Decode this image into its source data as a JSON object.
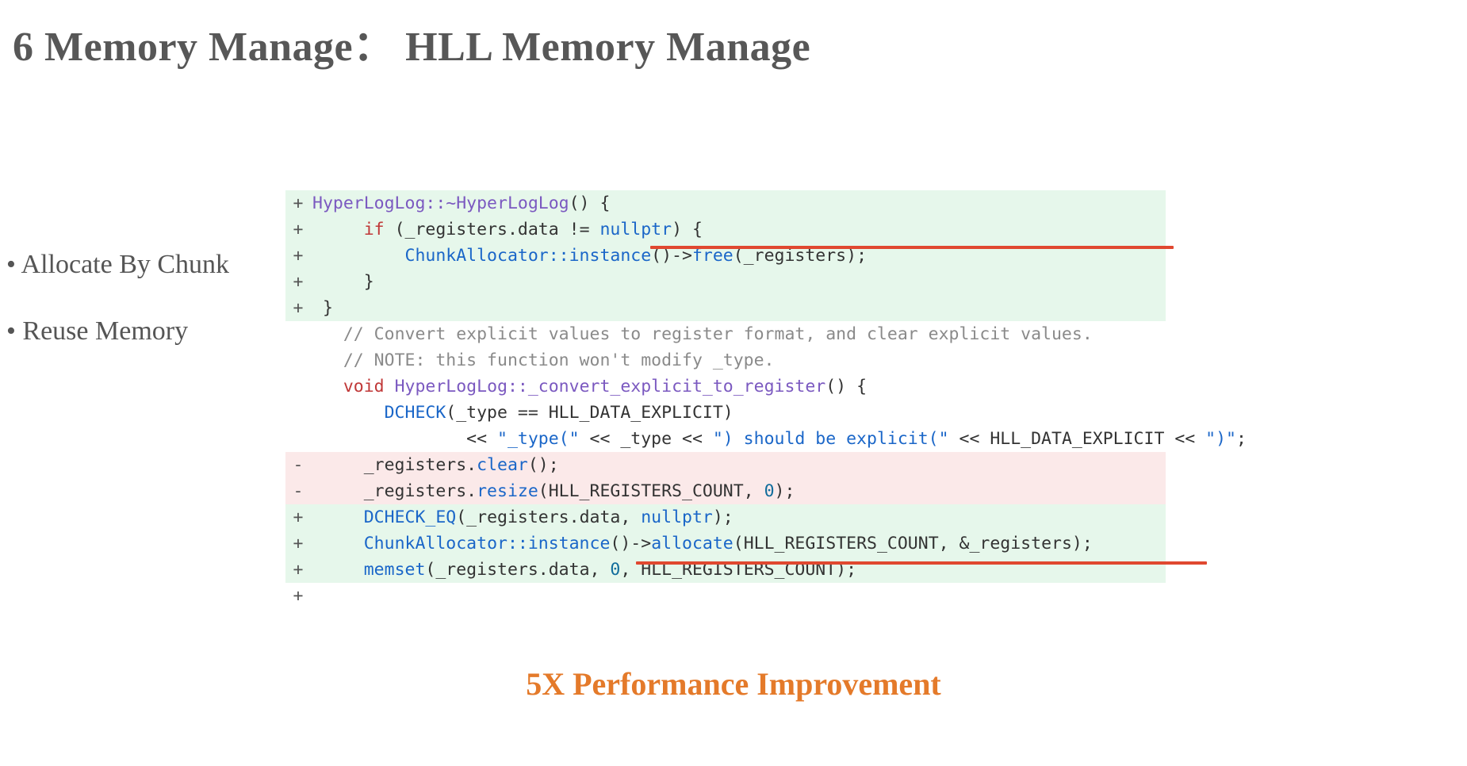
{
  "title": "6 Memory Manage： HLL Memory Manage",
  "bullets": [
    "Allocate By Chunk",
    "Reuse Memory"
  ],
  "callout": "5X Performance Improvement",
  "code": {
    "lines": [
      {
        "kind": "add",
        "sign": "+",
        "tokens": [
          {
            "t": "HyperLogLog::~HyperLogLog",
            "cls": "type"
          },
          {
            "t": "() {"
          }
        ]
      },
      {
        "kind": "add",
        "sign": "+",
        "tokens": [
          {
            "t": "     "
          },
          {
            "t": "if",
            "cls": "k-red"
          },
          {
            "t": " (_registers.data != "
          },
          {
            "t": "nullptr",
            "cls": "k-null"
          },
          {
            "t": ") {"
          }
        ]
      },
      {
        "kind": "add",
        "sign": "+",
        "tokens": [
          {
            "t": "         "
          },
          {
            "t": "ChunkAllocator::instance",
            "cls": "fn"
          },
          {
            "t": "()->"
          },
          {
            "t": "free",
            "cls": "fn"
          },
          {
            "t": "(_registers);"
          }
        ]
      },
      {
        "kind": "add",
        "sign": "+",
        "tokens": [
          {
            "t": "     }"
          }
        ]
      },
      {
        "kind": "add",
        "sign": "+",
        "tokens": [
          {
            "t": " }"
          }
        ]
      },
      {
        "kind": "add",
        "sign": "+",
        "tokens": [
          {
            "t": ""
          }
        ]
      },
      {
        "kind": "ctx",
        "sign": "",
        "tokens": [
          {
            "t": "   "
          },
          {
            "t": "// Convert explicit values to register format, and clear explicit values.",
            "cls": "comment"
          }
        ]
      },
      {
        "kind": "ctx",
        "sign": "",
        "tokens": [
          {
            "t": "   "
          },
          {
            "t": "// NOTE: this function won't modify _type.",
            "cls": "comment"
          }
        ]
      },
      {
        "kind": "ctx",
        "sign": "",
        "tokens": [
          {
            "t": "   "
          },
          {
            "t": "void",
            "cls": "k-red"
          },
          {
            "t": " "
          },
          {
            "t": "HyperLogLog::_convert_explicit_to_register",
            "cls": "type"
          },
          {
            "t": "() {"
          }
        ]
      },
      {
        "kind": "ctx",
        "sign": "",
        "tokens": [
          {
            "t": "       "
          },
          {
            "t": "DCHECK",
            "cls": "fn"
          },
          {
            "t": "(_type == HLL_DATA_EXPLICIT)"
          }
        ]
      },
      {
        "kind": "ctx",
        "sign": "",
        "tokens": [
          {
            "t": "               << "
          },
          {
            "t": "\"_type(\"",
            "cls": "string"
          },
          {
            "t": " << _type << "
          },
          {
            "t": "\") should be explicit(\"",
            "cls": "string"
          },
          {
            "t": " << HLL_DATA_EXPLICIT << "
          },
          {
            "t": "\")\"",
            "cls": "string"
          },
          {
            "t": ";"
          }
        ]
      },
      {
        "kind": "del",
        "sign": "-",
        "tokens": [
          {
            "t": "     _registers."
          },
          {
            "t": "clear",
            "cls": "fn"
          },
          {
            "t": "();"
          }
        ]
      },
      {
        "kind": "del",
        "sign": "-",
        "tokens": [
          {
            "t": "     _registers."
          },
          {
            "t": "resize",
            "cls": "fn"
          },
          {
            "t": "(HLL_REGISTERS_COUNT, "
          },
          {
            "t": "0",
            "cls": "k-num"
          },
          {
            "t": ");"
          }
        ]
      },
      {
        "kind": "add",
        "sign": "+",
        "tokens": [
          {
            "t": "     "
          },
          {
            "t": "DCHECK_EQ",
            "cls": "fn"
          },
          {
            "t": "(_registers.data, "
          },
          {
            "t": "nullptr",
            "cls": "k-null"
          },
          {
            "t": ");"
          }
        ]
      },
      {
        "kind": "add",
        "sign": "+",
        "tokens": [
          {
            "t": "     "
          },
          {
            "t": "ChunkAllocator::instance",
            "cls": "fn"
          },
          {
            "t": "()->"
          },
          {
            "t": "allocate",
            "cls": "fn"
          },
          {
            "t": "(HLL_REGISTERS_COUNT, &_registers);"
          }
        ]
      },
      {
        "kind": "add",
        "sign": "+",
        "tokens": [
          {
            "t": "     "
          },
          {
            "t": "memset",
            "cls": "fn"
          },
          {
            "t": "(_registers.data, "
          },
          {
            "t": "0",
            "cls": "k-num"
          },
          {
            "t": ", HLL_REGISTERS_COUNT);"
          }
        ]
      },
      {
        "kind": "add",
        "sign": "+",
        "tokens": [
          {
            "t": ""
          }
        ]
      }
    ]
  }
}
